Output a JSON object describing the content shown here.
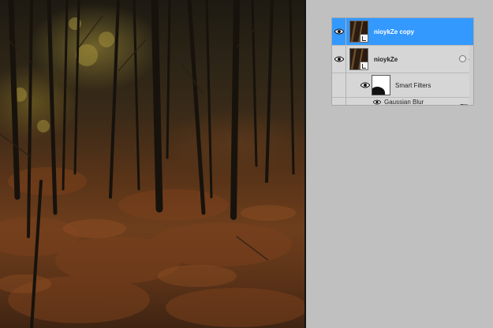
{
  "canvas": {
    "description_tokens": [
      "trees",
      "ferns"
    ]
  },
  "layers_panel": {
    "layers": [
      {
        "name": "nioykZe copy",
        "selected": true,
        "visible": true,
        "thumb_icon": "smart-object-badge-icon"
      },
      {
        "name": "nioykZe",
        "selected": false,
        "visible": true,
        "thumb_icon": "smart-object-badge-icon",
        "fx_icon": "layer-style-icon"
      }
    ],
    "smart_filters": {
      "label": "Smart Filters",
      "visible": true,
      "mask_icon": "filter-mask-icon",
      "filters": [
        {
          "name": "Gaussian Blur",
          "visible": true,
          "options_icon": "filter-options-icon"
        }
      ]
    }
  },
  "colors": {
    "selected_row": "#3399ff",
    "panel_bg": "#d6d6d6",
    "workspace_bg": "#c0c0c0"
  }
}
